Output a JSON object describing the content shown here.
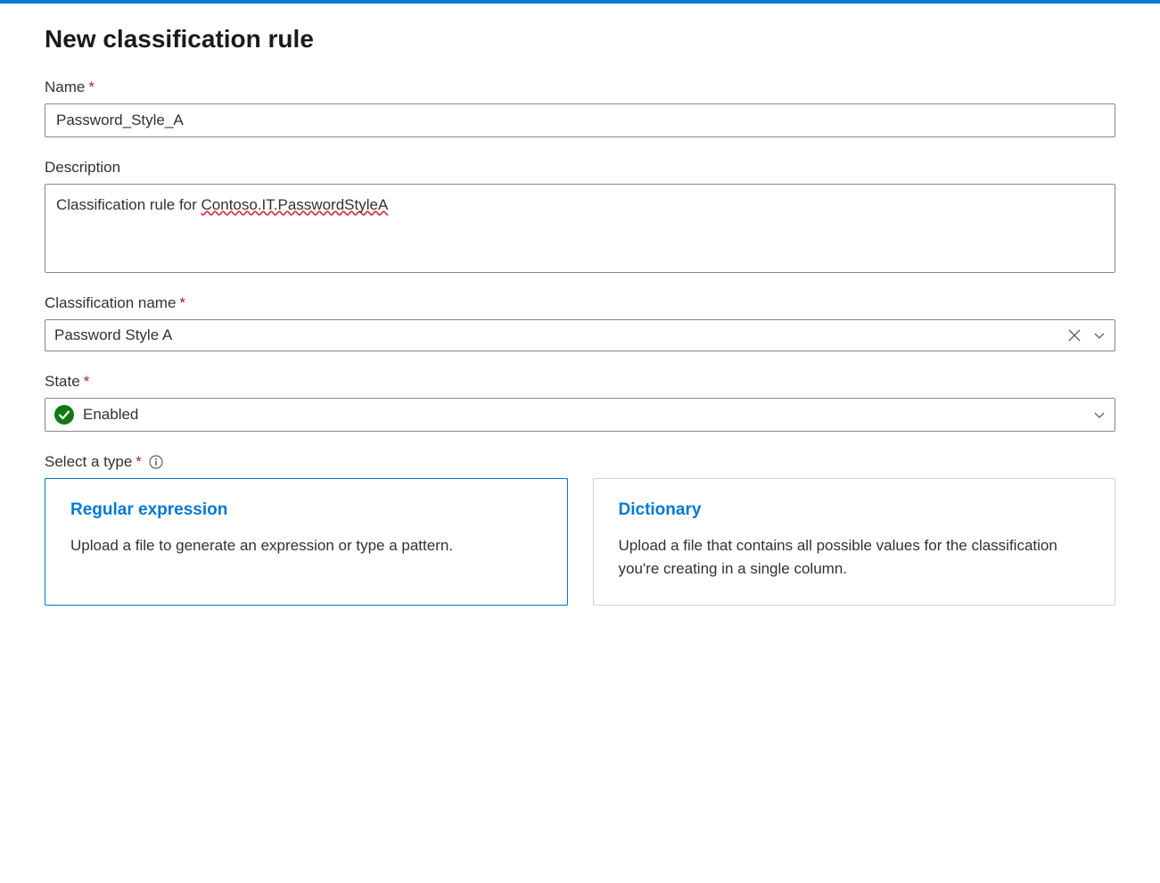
{
  "title": "New classification rule",
  "fields": {
    "name": {
      "label": "Name",
      "required": true,
      "value": "Password_Style_A"
    },
    "description": {
      "label": "Description",
      "required": false,
      "value_prefix": "Classification rule for ",
      "value_spellcheck": "Contoso.IT.PasswordStyleA"
    },
    "classification_name": {
      "label": "Classification name",
      "required": true,
      "value": "Password Style A"
    },
    "state": {
      "label": "State",
      "required": true,
      "value": "Enabled"
    },
    "select_type": {
      "label": "Select a type",
      "required": true
    }
  },
  "type_options": {
    "regex": {
      "title": "Regular expression",
      "description": "Upload a file to generate an expression or type a pattern.",
      "selected": true
    },
    "dictionary": {
      "title": "Dictionary",
      "description": "Upload a file that contains all possible values for the classification you're creating in a single column.",
      "selected": false
    }
  }
}
